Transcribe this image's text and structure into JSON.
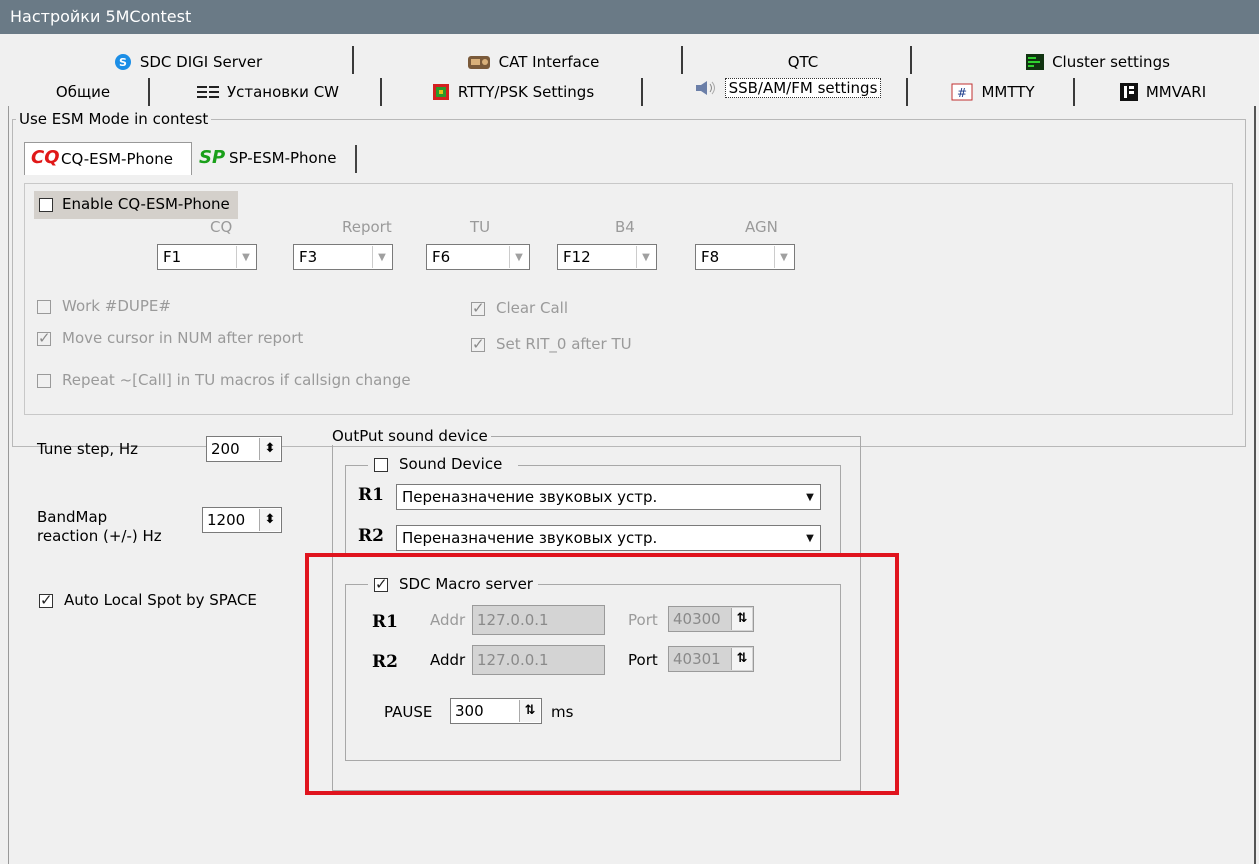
{
  "window": {
    "title": "Настройки 5MContest"
  },
  "tabs": {
    "row1": [
      {
        "label": "SDC DIGI Server",
        "icon": "sdc-icon"
      },
      {
        "label": "CAT Interface",
        "icon": "radio-icon"
      },
      {
        "label": "QTC",
        "icon": ""
      },
      {
        "label": "Cluster settings",
        "icon": "cluster-icon"
      }
    ],
    "row2": [
      {
        "label": "Общие",
        "icon": ""
      },
      {
        "label": "Установки CW",
        "icon": "cw-icon"
      },
      {
        "label": "RTTY/PSK Settings",
        "icon": "rtty-icon"
      },
      {
        "label": "SSB/AM/FM settings",
        "icon": "speaker-icon",
        "active": true
      },
      {
        "label": "MMTTY",
        "icon": "mmtty-icon"
      },
      {
        "label": "MMVARI",
        "icon": "mmvari-icon"
      }
    ]
  },
  "esm": {
    "group_title": "Use ESM Mode in contest",
    "subtabs": [
      {
        "label": "CQ-ESM-Phone",
        "badge": "CQ",
        "active": true
      },
      {
        "label": "SP-ESM-Phone",
        "badge": "SP"
      }
    ],
    "enable_label": "Enable CQ-ESM-Phone",
    "enable_checked": false,
    "keys": [
      {
        "header": "CQ",
        "value": "F1"
      },
      {
        "header": "Report",
        "value": "F3"
      },
      {
        "header": "TU",
        "value": "F6"
      },
      {
        "header": "B4",
        "value": "F12"
      },
      {
        "header": "AGN",
        "value": "F8"
      }
    ],
    "options": {
      "work_dupe": {
        "label": "Work #DUPE#",
        "checked": false
      },
      "move_cursor": {
        "label": "Move cursor in NUM after report",
        "checked": true
      },
      "repeat_call": {
        "label": "Repeat ~[Call] in TU macros if callsign change",
        "checked": false
      },
      "clear_call": {
        "label": "Clear Call",
        "checked": true
      },
      "set_rit": {
        "label": "Set RIT_0 after TU",
        "checked": true
      }
    }
  },
  "left": {
    "tune_step_label": "Tune step, Hz",
    "tune_step_value": "200",
    "bandmap_label_1": "BandMap",
    "bandmap_label_2": "reaction (+/-) Hz",
    "bandmap_value": "1200",
    "auto_spot_label": "Auto Local Spot by SPACE",
    "auto_spot_checked": true
  },
  "output": {
    "group_title": "OutPut sound device",
    "sound_device_label": "Sound Device",
    "sound_device_checked": false,
    "r1_label": "R1",
    "r1_value": "Переназначение звуковых устр.",
    "r2_label": "R2",
    "r2_value": "Переназначение звуковых устр.",
    "macro": {
      "label": "SDC Macro server",
      "checked": true,
      "r1": {
        "label": "R1",
        "addr_label": "Addr",
        "addr": "127.0.0.1",
        "port_label": "Port",
        "port": "40300"
      },
      "r2": {
        "label": "R2",
        "addr_label": "Addr",
        "addr": "127.0.0.1",
        "port_label": "Port",
        "port": "40301"
      },
      "pause_label": "PAUSE",
      "pause_value": "300",
      "pause_unit": "ms"
    }
  },
  "colors": {
    "titlebar": "#6a7a86",
    "highlight": "#e0141e",
    "cq_badge": "#e01818",
    "sp_badge": "#1aa01a"
  }
}
